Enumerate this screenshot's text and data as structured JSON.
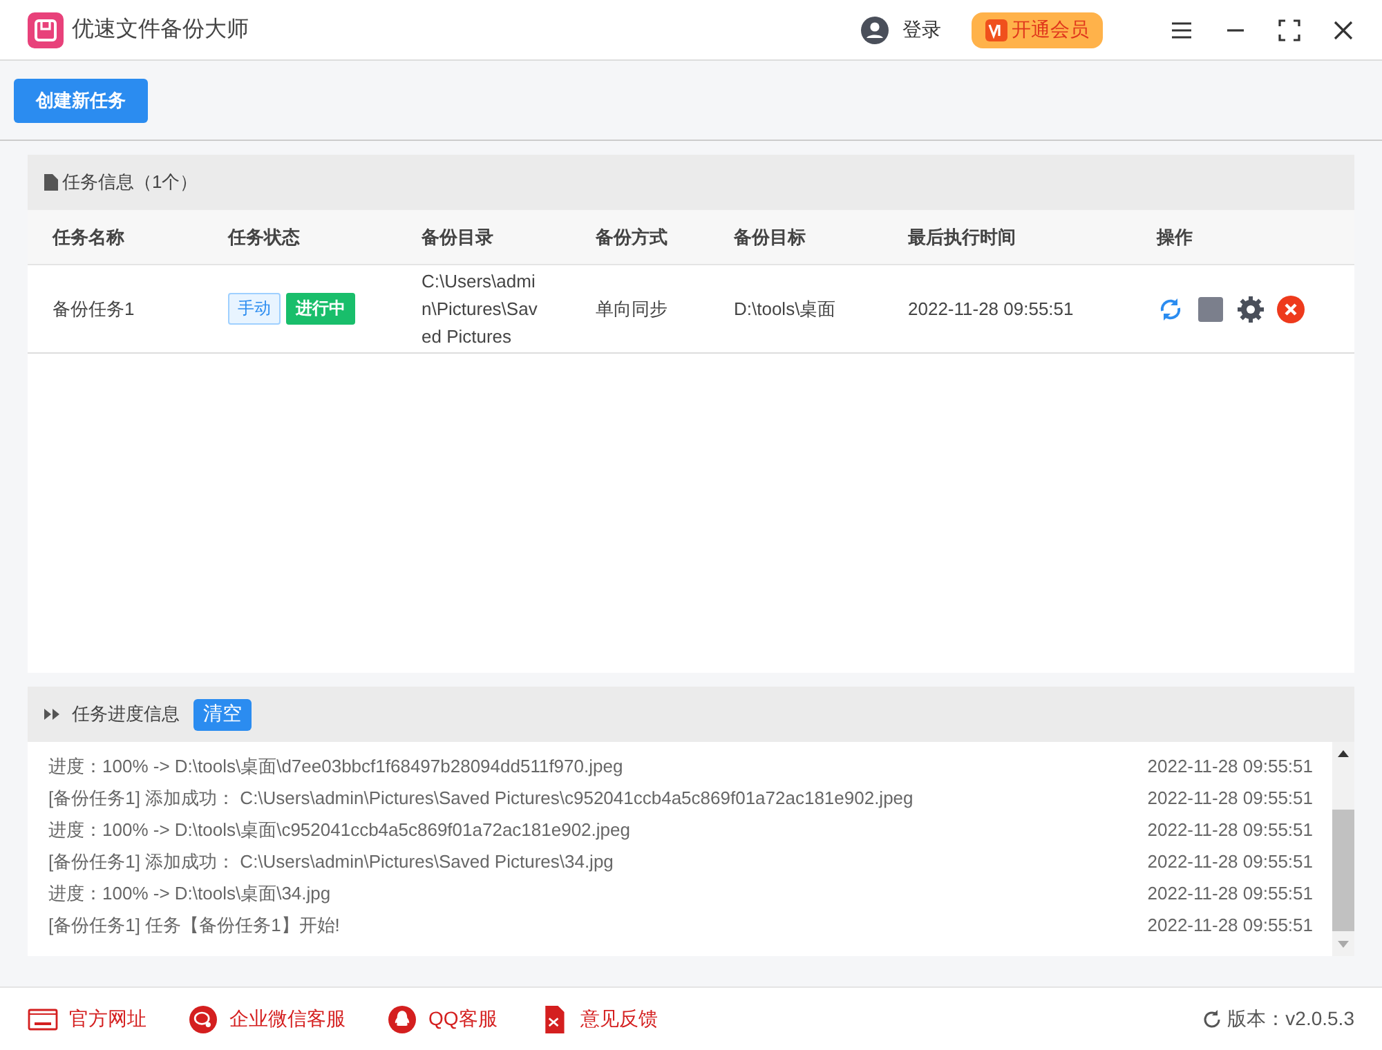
{
  "window": {
    "title": "优速文件备份大师"
  },
  "header": {
    "login": "登录",
    "vip": "开通会员"
  },
  "toolbar": {
    "create_button": "创建新任务"
  },
  "task_panel": {
    "title": "任务信息（1个）",
    "columns": [
      "任务名称",
      "任务状态",
      "备份目录",
      "备份方式",
      "备份目标",
      "最后执行时间",
      "操作"
    ],
    "rows": [
      {
        "name": "备份任务1",
        "mode_tag": "手动",
        "status_tag": "进行中",
        "source": "C:\\Users\\admin\\Pictures\\Saved Pictures",
        "method": "单向同步",
        "target": "D:\\tools\\桌面",
        "last_run": "2022-11-28 09:55:51"
      }
    ]
  },
  "log_panel": {
    "title": "任务进度信息",
    "clear_button": "清空",
    "entries": [
      {
        "message": "进度：100% -> D:\\tools\\桌面\\d7ee03bbcf1f68497b28094dd511f970.jpeg",
        "time": "2022-11-28 09:55:51"
      },
      {
        "message": "[备份任务1] 添加成功：  C:\\Users\\admin\\Pictures\\Saved Pictures\\c952041ccb4a5c869f01a72ac181e902.jpeg",
        "time": "2022-11-28 09:55:51"
      },
      {
        "message": "进度：100% -> D:\\tools\\桌面\\c952041ccb4a5c869f01a72ac181e902.jpeg",
        "time": "2022-11-28 09:55:51"
      },
      {
        "message": "[备份任务1] 添加成功：  C:\\Users\\admin\\Pictures\\Saved Pictures\\34.jpg",
        "time": "2022-11-28 09:55:51"
      },
      {
        "message": "进度：100% -> D:\\tools\\桌面\\34.jpg",
        "time": "2022-11-28 09:55:51"
      },
      {
        "message": "[备份任务1] 任务【备份任务1】开始!",
        "time": "2022-11-28 09:55:51"
      }
    ]
  },
  "footer": {
    "links": [
      {
        "kind": "web",
        "label": "官方网址"
      },
      {
        "kind": "wechat",
        "label": "企业微信客服"
      },
      {
        "kind": "qq",
        "label": "QQ客服"
      },
      {
        "kind": "feedback",
        "label": "意见反馈"
      }
    ],
    "version": "版本：v2.0.5.3"
  }
}
